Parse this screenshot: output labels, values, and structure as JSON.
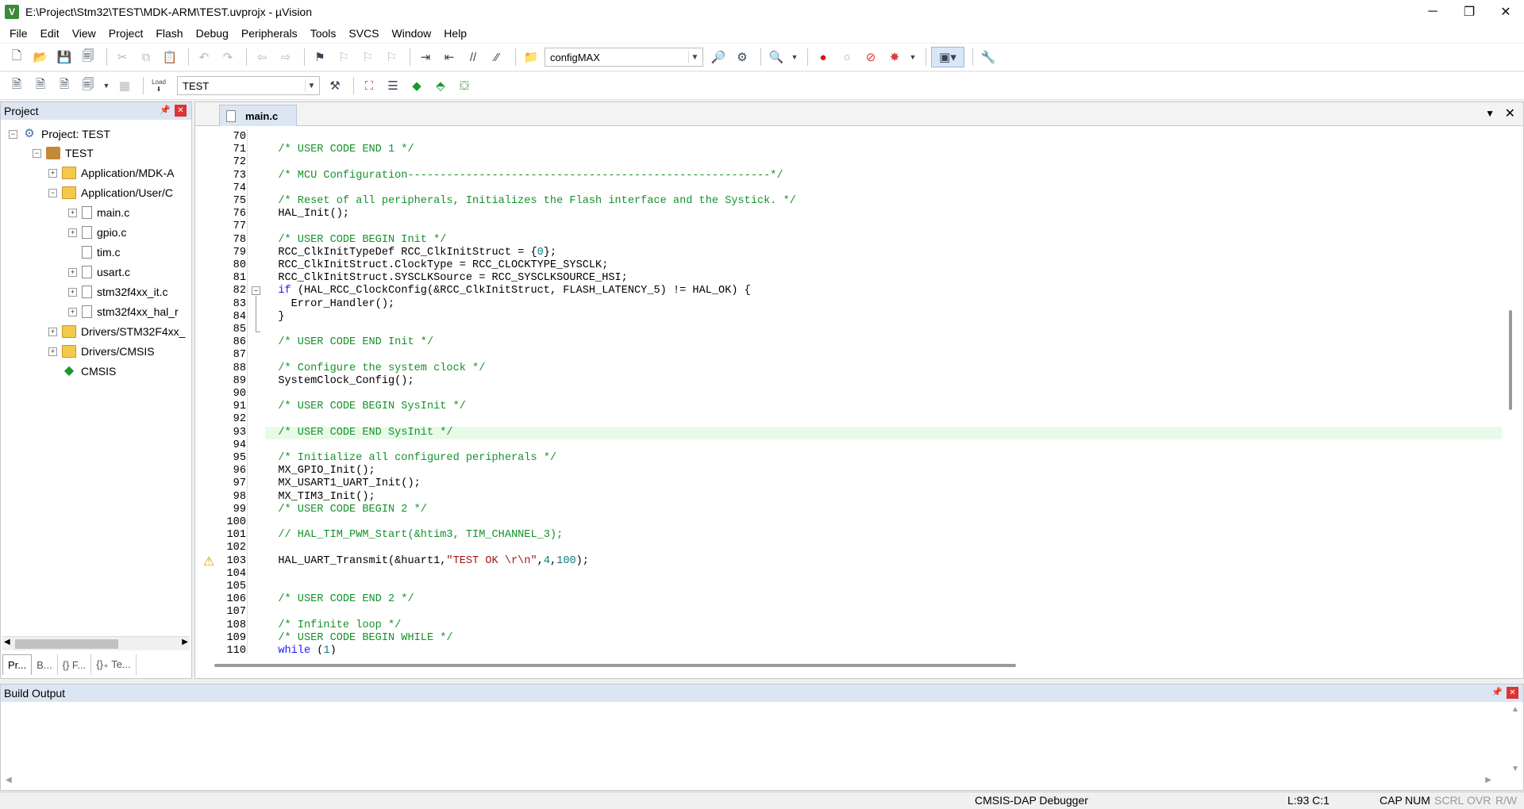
{
  "window": {
    "title": "E:\\Project\\Stm32\\TEST\\MDK-ARM\\TEST.uvprojx - µVision",
    "app_icon_glyph": "V",
    "minimize_glyph": "─",
    "restore_glyph": "❐",
    "close_glyph": "✕"
  },
  "menu": [
    "File",
    "Edit",
    "View",
    "Project",
    "Flash",
    "Debug",
    "Peripherals",
    "Tools",
    "SVCS",
    "Window",
    "Help"
  ],
  "toolbar1": {
    "find_combo_value": "configMAX"
  },
  "toolbar2": {
    "target_combo_value": "TEST",
    "load_label": "Load"
  },
  "project_panel": {
    "title": "Project",
    "pin_glyph": "📌",
    "close_glyph": "✕",
    "tree": [
      {
        "label": "Project: TEST",
        "icon": "project-icon",
        "expander": "−"
      },
      {
        "label": "TEST",
        "icon": "target-icon",
        "expander": "−"
      },
      {
        "label": "Application/MDK-A",
        "icon": "folder-icon",
        "expander": "+"
      },
      {
        "label": "Application/User/C",
        "icon": "folder-icon",
        "expander": "−"
      },
      {
        "label": "main.c",
        "icon": "file-icon",
        "expander": "+"
      },
      {
        "label": "gpio.c",
        "icon": "file-icon",
        "expander": "+"
      },
      {
        "label": "tim.c",
        "icon": "gear-file-icon",
        "expander": ""
      },
      {
        "label": "usart.c",
        "icon": "gear-file-icon",
        "expander": "+"
      },
      {
        "label": "stm32f4xx_it.c",
        "icon": "file-icon",
        "expander": "+"
      },
      {
        "label": "stm32f4xx_hal_r",
        "icon": "file-icon",
        "expander": "+"
      },
      {
        "label": "Drivers/STM32F4xx_",
        "icon": "folder-icon",
        "expander": "+"
      },
      {
        "label": "Drivers/CMSIS",
        "icon": "folder-icon",
        "expander": "+"
      },
      {
        "label": "CMSIS",
        "icon": "cmsis-icon",
        "expander": ""
      }
    ],
    "bottom_tabs": [
      "Pr...",
      "B...",
      "{} F...",
      "{}₊ Te..."
    ]
  },
  "editor": {
    "active_tab": "main.c",
    "dropdown_glyph": "▼",
    "close_glyph": "✕",
    "current_line": 93,
    "fold_line": 82,
    "warning_line": 103,
    "warning_glyph": "⚠",
    "lines": [
      {
        "n": "70",
        "segs": []
      },
      {
        "n": "71",
        "segs": [
          {
            "t": "  /* USER CODE END 1 */",
            "c": "cmt"
          }
        ]
      },
      {
        "n": "72",
        "segs": []
      },
      {
        "n": "73",
        "segs": [
          {
            "t": "  /* MCU Configuration--------------------------------------------------------*/",
            "c": "cmt"
          }
        ]
      },
      {
        "n": "74",
        "segs": []
      },
      {
        "n": "75",
        "segs": [
          {
            "t": "  /* Reset of all peripherals, Initializes the Flash interface and the Systick. */",
            "c": "cmt"
          }
        ]
      },
      {
        "n": "76",
        "segs": [
          {
            "t": "  HAL_Init();",
            "c": "txt"
          }
        ]
      },
      {
        "n": "77",
        "segs": []
      },
      {
        "n": "78",
        "segs": [
          {
            "t": "  /* USER CODE BEGIN Init */",
            "c": "cmt"
          }
        ]
      },
      {
        "n": "79",
        "segs": [
          {
            "t": "  RCC_ClkInitTypeDef RCC_ClkInitStruct = {",
            "c": "txt"
          },
          {
            "t": "0",
            "c": "num"
          },
          {
            "t": "};",
            "c": "txt"
          }
        ]
      },
      {
        "n": "80",
        "segs": [
          {
            "t": "  RCC_ClkInitStruct.ClockType = RCC_CLOCKTYPE_SYSCLK;",
            "c": "txt"
          }
        ]
      },
      {
        "n": "81",
        "segs": [
          {
            "t": "  RCC_ClkInitStruct.SYSCLKSource = RCC_SYSCLKSOURCE_HSI;",
            "c": "txt"
          }
        ]
      },
      {
        "n": "82",
        "segs": [
          {
            "t": "  ",
            "c": "txt"
          },
          {
            "t": "if",
            "c": "kw"
          },
          {
            "t": " (HAL_RCC_ClockConfig(&RCC_ClkInitStruct, FLASH_LATENCY_5) != HAL_OK) {",
            "c": "txt"
          }
        ]
      },
      {
        "n": "83",
        "segs": [
          {
            "t": "    Error_Handler();",
            "c": "txt"
          }
        ]
      },
      {
        "n": "84",
        "segs": [
          {
            "t": "  }",
            "c": "txt"
          }
        ]
      },
      {
        "n": "85",
        "segs": []
      },
      {
        "n": "86",
        "segs": [
          {
            "t": "  /* USER CODE END Init */",
            "c": "cmt"
          }
        ]
      },
      {
        "n": "87",
        "segs": []
      },
      {
        "n": "88",
        "segs": [
          {
            "t": "  /* Configure the system clock */",
            "c": "cmt"
          }
        ]
      },
      {
        "n": "89",
        "segs": [
          {
            "t": "  SystemClock_Config();",
            "c": "txt"
          }
        ]
      },
      {
        "n": "90",
        "segs": []
      },
      {
        "n": "91",
        "segs": [
          {
            "t": "  /* USER CODE BEGIN SysInit */",
            "c": "cmt"
          }
        ]
      },
      {
        "n": "92",
        "segs": []
      },
      {
        "n": "93",
        "segs": [
          {
            "t": "  /* USER CODE END SysInit */",
            "c": "cmt"
          }
        ]
      },
      {
        "n": "94",
        "segs": []
      },
      {
        "n": "95",
        "segs": [
          {
            "t": "  /* Initialize all configured peripherals */",
            "c": "cmt"
          }
        ]
      },
      {
        "n": "96",
        "segs": [
          {
            "t": "  MX_GPIO_Init();",
            "c": "txt"
          }
        ]
      },
      {
        "n": "97",
        "segs": [
          {
            "t": "  MX_USART1_UART_Init();",
            "c": "txt"
          }
        ]
      },
      {
        "n": "98",
        "segs": [
          {
            "t": "  MX_TIM3_Init();",
            "c": "txt"
          }
        ]
      },
      {
        "n": "99",
        "segs": [
          {
            "t": "  /* USER CODE BEGIN 2 */",
            "c": "cmt"
          }
        ]
      },
      {
        "n": "100",
        "segs": []
      },
      {
        "n": "101",
        "segs": [
          {
            "t": "  // HAL_TIM_PWM_Start(&htim3, TIM_CHANNEL_3);",
            "c": "cmt"
          }
        ]
      },
      {
        "n": "102",
        "segs": []
      },
      {
        "n": "103",
        "segs": [
          {
            "t": "  HAL_UART_Transmit(&huart1,",
            "c": "txt"
          },
          {
            "t": "\"TEST OK \\r\\n\"",
            "c": "str"
          },
          {
            "t": ",",
            "c": "txt"
          },
          {
            "t": "4",
            "c": "num"
          },
          {
            "t": ",",
            "c": "txt"
          },
          {
            "t": "100",
            "c": "num"
          },
          {
            "t": ");",
            "c": "txt"
          }
        ]
      },
      {
        "n": "104",
        "segs": []
      },
      {
        "n": "105",
        "segs": []
      },
      {
        "n": "106",
        "segs": [
          {
            "t": "  /* USER CODE END 2 */",
            "c": "cmt"
          }
        ]
      },
      {
        "n": "107",
        "segs": []
      },
      {
        "n": "108",
        "segs": [
          {
            "t": "  /* Infinite loop */",
            "c": "cmt"
          }
        ]
      },
      {
        "n": "109",
        "segs": [
          {
            "t": "  /* USER CODE BEGIN WHILE */",
            "c": "cmt"
          }
        ]
      },
      {
        "n": "110",
        "segs": [
          {
            "t": "  ",
            "c": "txt"
          },
          {
            "t": "while",
            "c": "kw"
          },
          {
            "t": " (",
            "c": "txt"
          },
          {
            "t": "1",
            "c": "num"
          },
          {
            "t": ")",
            "c": "txt"
          }
        ]
      }
    ]
  },
  "build_output": {
    "title": "Build Output",
    "pin_glyph": "📌",
    "close_glyph": "✕"
  },
  "status": {
    "debugger": "CMSIS-DAP Debugger",
    "position": "L:93 C:1",
    "cap": "CAP",
    "num": "NUM",
    "scrl": "SCRL",
    "ovr": "OVR",
    "rw": "R/W"
  }
}
